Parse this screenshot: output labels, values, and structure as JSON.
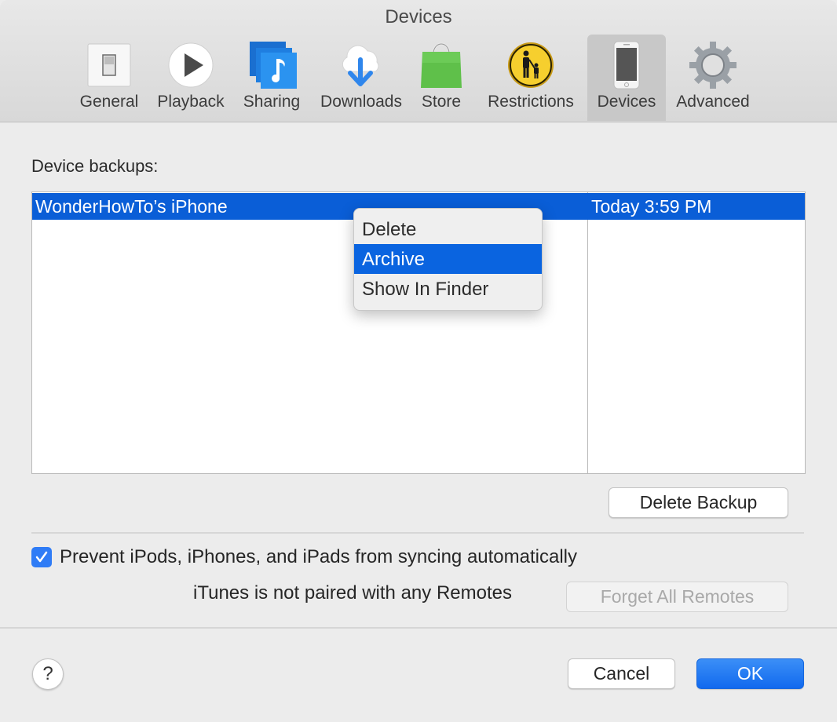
{
  "window": {
    "title": "Devices"
  },
  "toolbar": {
    "selected": "Devices",
    "items": [
      {
        "label": "General",
        "icon": "switch-icon"
      },
      {
        "label": "Playback",
        "icon": "play-icon"
      },
      {
        "label": "Sharing",
        "icon": "music-sharing-icon"
      },
      {
        "label": "Downloads",
        "icon": "cloud-download-icon"
      },
      {
        "label": "Store",
        "icon": "shopping-bag-icon"
      },
      {
        "label": "Restrictions",
        "icon": "parental-icon"
      },
      {
        "label": "Devices",
        "icon": "iphone-icon"
      },
      {
        "label": "Advanced",
        "icon": "gear-icon"
      }
    ]
  },
  "backups": {
    "section_label": "Device backups:",
    "rows": [
      {
        "name": "WonderHowTo’s iPhone",
        "date": "Today 3:59 PM",
        "selected": true
      }
    ],
    "delete_backup_label": "Delete Backup"
  },
  "context_menu": {
    "items": [
      {
        "label": "Delete",
        "highlighted": false
      },
      {
        "label": "Archive",
        "highlighted": true
      },
      {
        "label": "Show In Finder",
        "highlighted": false
      }
    ]
  },
  "options": {
    "prevent_sync_label": "Prevent iPods, iPhones, and iPads from syncing automatically",
    "prevent_sync_checked": true,
    "remotes_status": "iTunes is not paired with any Remotes",
    "forget_remotes_label": "Forget All Remotes",
    "forget_remotes_enabled": false
  },
  "footer": {
    "help_label": "?",
    "cancel_label": "Cancel",
    "ok_label": "OK"
  },
  "colors": {
    "selection": "#0a5ed7",
    "accent": "#1169ee",
    "background": "#ececec"
  }
}
